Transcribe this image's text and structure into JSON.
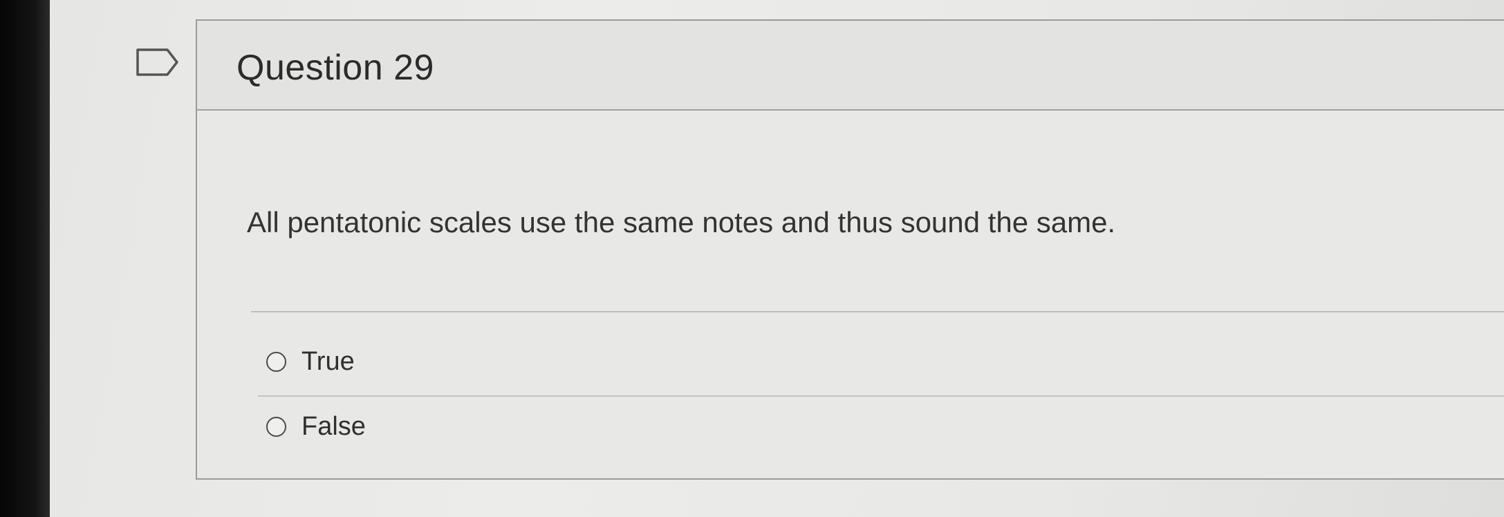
{
  "question": {
    "title": "Question 29",
    "text": "All pentatonic scales use the same notes and thus sound the same.",
    "answers": [
      {
        "label": "True",
        "selected": false
      },
      {
        "label": "False",
        "selected": false
      }
    ]
  },
  "icons": {
    "flag": "flag-icon",
    "radio": "radio-button-icon"
  }
}
